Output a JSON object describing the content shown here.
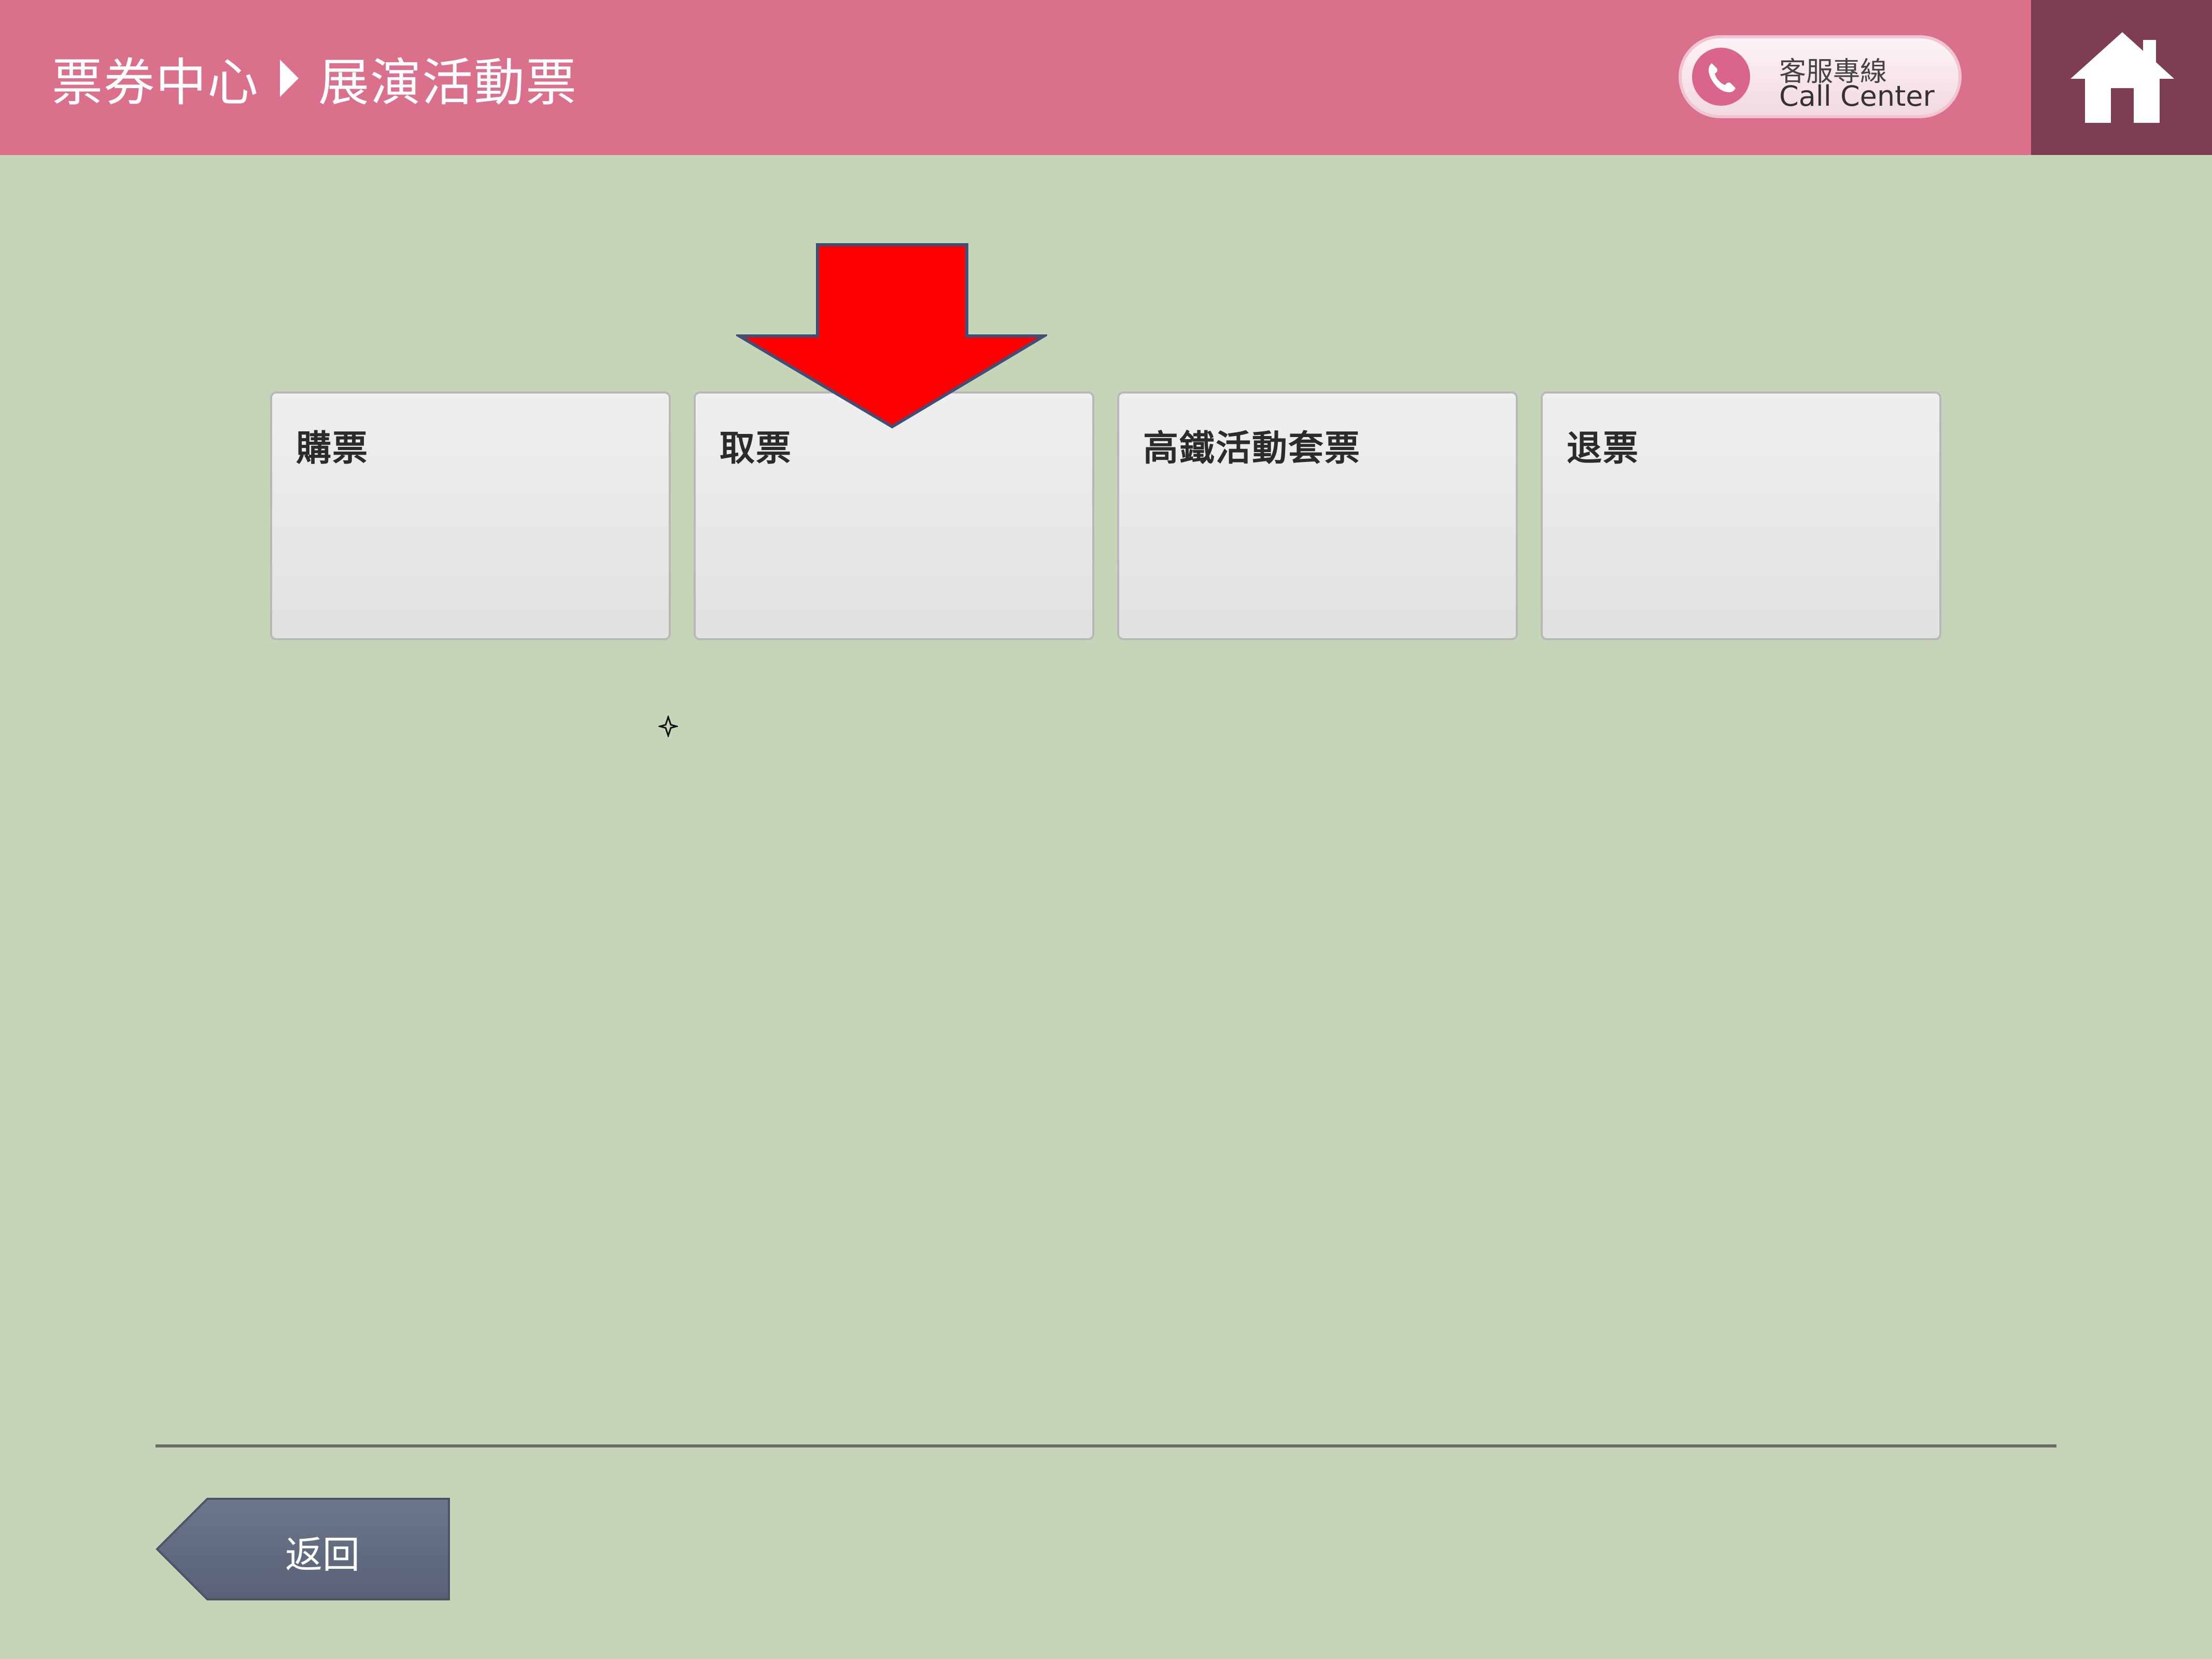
{
  "header": {
    "breadcrumb": [
      "票券中心",
      "展演活動票"
    ],
    "call_center": {
      "label_zh": "客服專線",
      "label_en": "Call Center"
    },
    "home_icon": "home-icon",
    "colors": {
      "bar": "#db708d",
      "home": "#7e3d52"
    }
  },
  "options": [
    {
      "label": "購票"
    },
    {
      "label": "取票"
    },
    {
      "label": "高鐵活動套票"
    },
    {
      "label": "退票"
    }
  ],
  "annotation": {
    "type": "arrow-down",
    "color": "#ff0000",
    "points_to": "取票"
  },
  "footer": {
    "back_label": "返回"
  },
  "colors": {
    "background": "#c6d4b7",
    "tile": "#e8e8e8",
    "back_button": "#5f697d"
  }
}
